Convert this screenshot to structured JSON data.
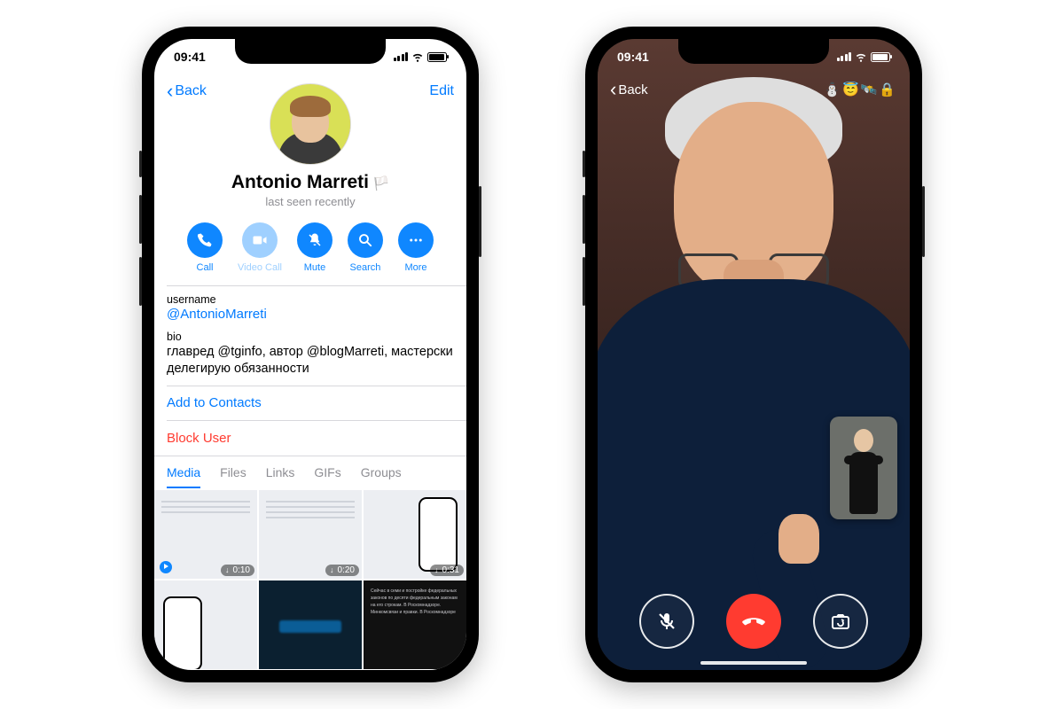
{
  "status": {
    "time": "09:41"
  },
  "left": {
    "nav": {
      "back": "Back",
      "edit": "Edit"
    },
    "name": "Antonio Marreti",
    "flag": "🏳️",
    "presence": "last seen recently",
    "actions": {
      "call": "Call",
      "video": "Video Call",
      "mute": "Mute",
      "search": "Search",
      "more": "More"
    },
    "labels": {
      "username": "username",
      "bio": "bio"
    },
    "username": "@AntonioMarreti",
    "bio": "главред @tginfo, автор @blogMarreti, мастерски делегирую обязанности",
    "add_contacts": "Add to Contacts",
    "block": "Block User",
    "tabs": {
      "media": "Media",
      "files": "Files",
      "links": "Links",
      "gifs": "GIFs",
      "groups": "Groups"
    },
    "media": {
      "d1": "0:10",
      "d2": "0:20",
      "d3": "0:31"
    }
  },
  "right": {
    "nav": {
      "back": "Back",
      "emojis": "⛄😇🛰️🔒"
    }
  }
}
